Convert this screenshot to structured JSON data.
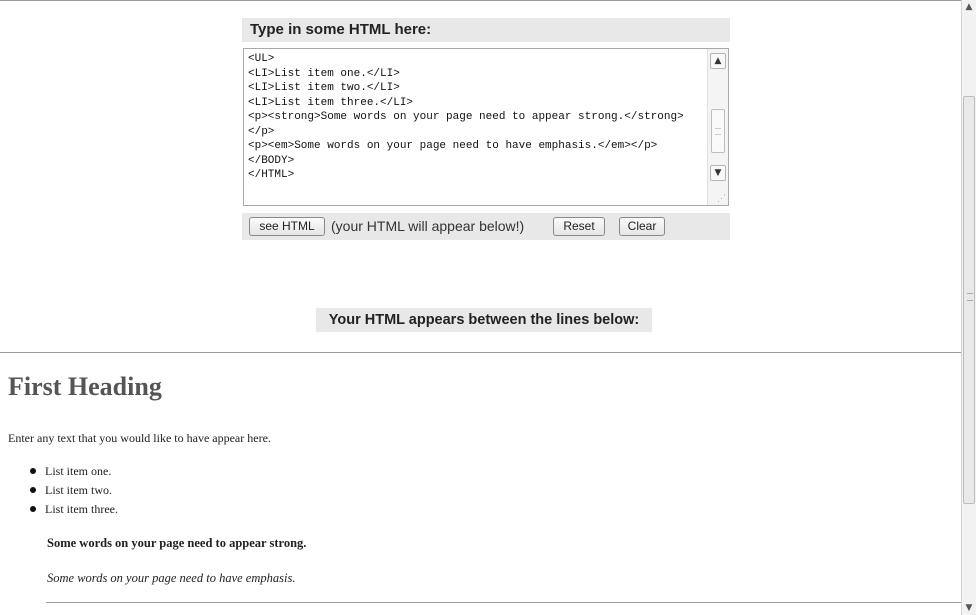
{
  "editor": {
    "title": "Type in some HTML here:",
    "content": "<UL>\n<LI>List item one.</LI>\n<LI>List item two.</LI>\n<LI>List item three.</LI>\n<p><strong>Some words on your page need to appear strong.</strong></p>\n<p><em>Some words on your page need to have emphasis.</em></p>\n</BODY>\n</HTML>"
  },
  "controls": {
    "see_html_label": "see HTML",
    "hint": "(your HTML will appear below!)",
    "reset_label": "Reset",
    "clear_label": "Clear"
  },
  "output_section": {
    "label": "Your HTML appears between the lines below:"
  },
  "output": {
    "heading": "First Heading",
    "paragraph": "Enter any text that you would like to have appear here.",
    "list_items": [
      "List item one.",
      "List item two.",
      "List item three."
    ],
    "strong_text": "Some words on your page need to appear strong.",
    "em_text": "Some words on your page need to have emphasis."
  },
  "icons": {
    "scroll_up": "up-arrow-icon",
    "scroll_down": "down-arrow-icon"
  }
}
